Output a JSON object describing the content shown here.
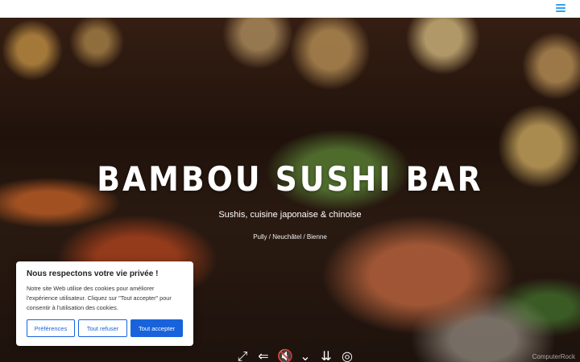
{
  "header": {
    "menu_icon": "hamburger-icon",
    "accent_color": "#2ea3f2"
  },
  "hero": {
    "title": "BAMBOU SUSHI BAR",
    "subtitle": "Sushis, cuisine japonaise & chinoise",
    "locations": "Pully / Neuchâtel  / Bienne",
    "media_icons": [
      "expand-icon",
      "back-arrow-icon",
      "mute-icon",
      "chevron-down-icon",
      "double-chevron-down-icon",
      "circle-check-icon"
    ]
  },
  "cookie_banner": {
    "title": "Nous respectons votre vie privée !",
    "text": "Notre site Web utilise des cookies pour améliorer l'expérience utilisateur. Cliquez sur \"Tout accepter\" pour consentir à l'utilisation des cookies.",
    "preferences_label": "Préférences",
    "refuse_label": "Tout refuser",
    "accept_label": "Tout accepter",
    "brand_color": "#1863dc"
  },
  "watermark": "ComputerRock"
}
